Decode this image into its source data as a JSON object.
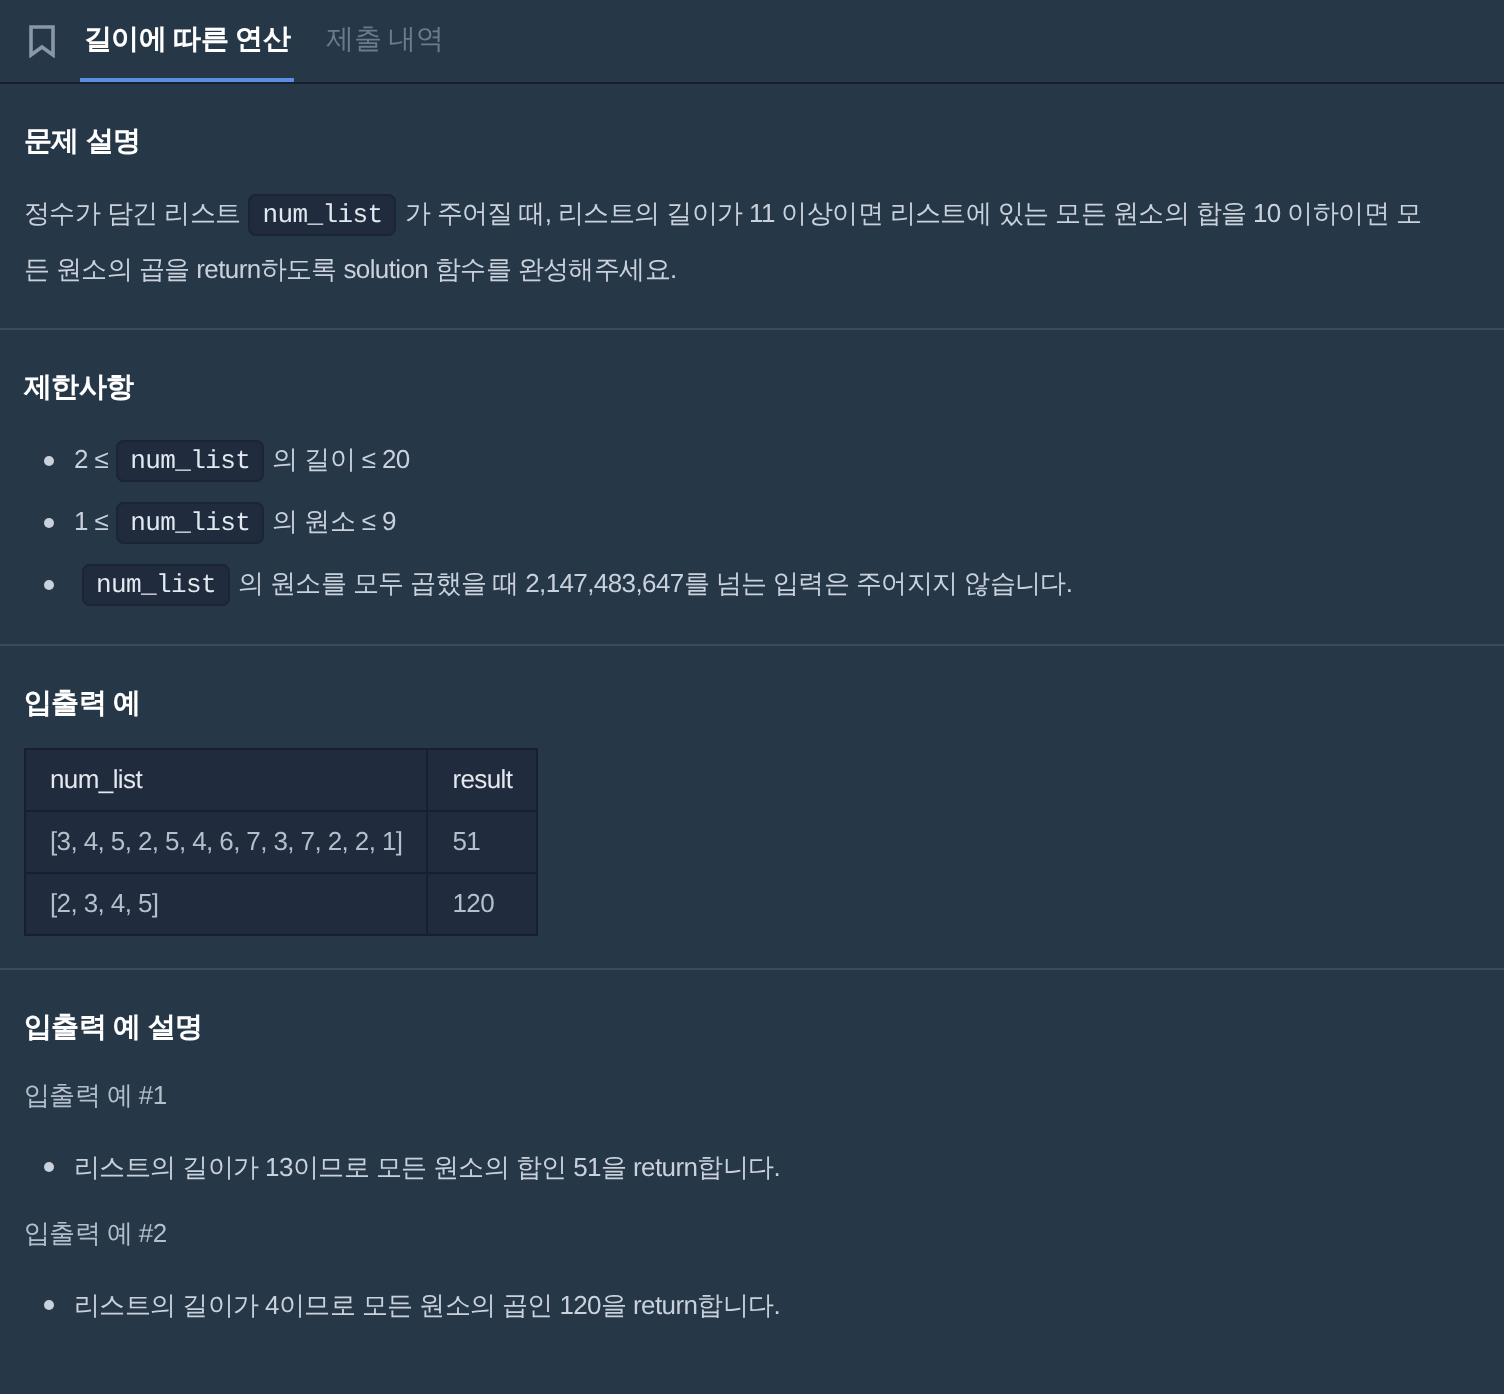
{
  "tabs": [
    {
      "label": "길이에 따른 연산",
      "selected": true
    },
    {
      "label": "제출 내역",
      "selected": false
    }
  ],
  "sections": [
    {
      "kind": "paragraph",
      "heading": "문제 설명",
      "lines": [
        [
          {
            "kind": "text",
            "text": "정수가 담긴 리스트"
          },
          {
            "kind": "code",
            "text": "num_list"
          },
          {
            "kind": "text",
            "text": "가 주어질 때, 리스트의 길이가 11 이상이면 리스트에 있는 모든 원소의 합을 10 이하이면 모"
          }
        ],
        [
          {
            "kind": "text",
            "text": "든 원소의 곱을 return하도록 solution 함수를 완성해주세요."
          }
        ]
      ]
    },
    {
      "kind": "bullets",
      "heading": "제한사항",
      "items": [
        [
          {
            "kind": "text",
            "text": "2 ≤"
          },
          {
            "kind": "code",
            "text": "num_list"
          },
          {
            "kind": "text",
            "text": "의 길이 ≤ 20"
          }
        ],
        [
          {
            "kind": "text",
            "text": "1 ≤"
          },
          {
            "kind": "code",
            "text": "num_list"
          },
          {
            "kind": "text",
            "text": "의 원소 ≤ 9"
          }
        ],
        [
          {
            "kind": "code",
            "text": "num_list"
          },
          {
            "kind": "text",
            "text": "의 원소를 모두 곱했을 때 2,147,483,647를 넘는 입력은 주어지지 않습니다."
          }
        ]
      ]
    },
    {
      "kind": "table",
      "heading": "입출력 예",
      "columns": [
        "num_list",
        "result"
      ],
      "rows": [
        [
          "[3, 4, 5, 2, 5, 4, 6, 7, 3, 7, 2, 2, 1]",
          "51"
        ],
        [
          "[2, 3, 4, 5]",
          "120"
        ]
      ]
    },
    {
      "kind": "examples",
      "heading": "입출력 예 설명",
      "examples": [
        {
          "title": "입출력 예 #1",
          "items": [
            [
              {
                "kind": "text",
                "text": "리스트의 길이가 13이므로 모든 원소의 합인 51을 return합니다."
              }
            ]
          ]
        },
        {
          "title": "입출력 예 #2",
          "items": [
            [
              {
                "kind": "text",
                "text": "리스트의 길이가 4이므로 모든 원소의 곱인 120을 return합니다."
              }
            ]
          ]
        }
      ]
    }
  ]
}
